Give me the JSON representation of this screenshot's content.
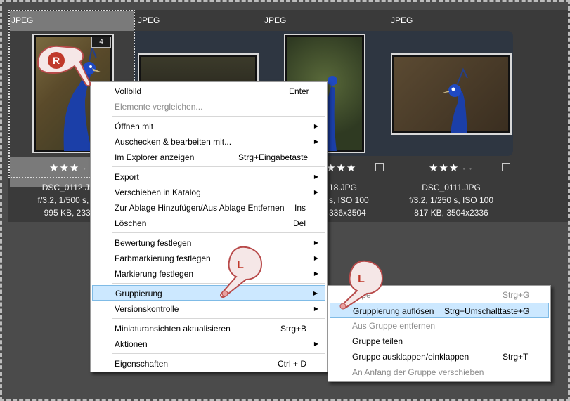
{
  "thumbnails": [
    {
      "format": "JPEG",
      "badge": "4",
      "stars": "★★★",
      "filename": "DSC_0112.JPG",
      "exposure": "f/3.2, 1/500 s, ISO",
      "size": "995 KB, 2336x"
    },
    {
      "format": "JPEG"
    },
    {
      "format": "JPEG",
      "stars": "★★★",
      "filename": "18.JPG",
      "exposure": "s, ISO 100",
      "size": "336x3504"
    },
    {
      "format": "JPEG",
      "stars": "★★★",
      "filename": "DSC_0111.JPG",
      "exposure": "f/3.2, 1/250 s, ISO 100",
      "size": "817 KB, 3504x2336"
    }
  ],
  "context_menu": {
    "items": [
      {
        "label": "Vollbild",
        "shortcut": "Enter"
      },
      {
        "label": "Elemente vergleichen...",
        "disabled": true
      },
      {
        "label": "Öffnen mit",
        "arrow": true
      },
      {
        "label": "Auschecken & bearbeiten mit...",
        "arrow": true
      },
      {
        "label": "Im Explorer anzeigen",
        "shortcut": "Strg+Eingabetaste"
      },
      {
        "label": "Export",
        "arrow": true
      },
      {
        "label": "Verschieben in Katalog",
        "arrow": true
      },
      {
        "label": "Zur Ablage Hinzufügen/Aus Ablage Entfernen",
        "shortcut": "Ins"
      },
      {
        "label": "Löschen",
        "shortcut": "Del"
      },
      {
        "label": "Bewertung festlegen",
        "arrow": true
      },
      {
        "label": "Farbmarkierung festlegen",
        "arrow": true
      },
      {
        "label": "Markierung festlegen",
        "arrow": true
      },
      {
        "label": "Gruppierung",
        "arrow": true,
        "highlighted": true
      },
      {
        "label": "Versionskontrolle",
        "arrow": true
      },
      {
        "label": "Miniaturansichten aktualisieren",
        "shortcut": "Strg+B"
      },
      {
        "label": "Aktionen",
        "arrow": true
      },
      {
        "label": "Eigenschaften",
        "shortcut": "Ctrl + D"
      }
    ]
  },
  "submenu": {
    "items": [
      {
        "label": "uppe",
        "shortcut": "Strg+G",
        "disabled": true
      },
      {
        "label": "Gruppierung auflösen",
        "shortcut": "Strg+Umschalttaste+G",
        "highlighted": true
      },
      {
        "label": "Aus Gruppe entfernen",
        "disabled": true
      },
      {
        "label": "Gruppe teilen"
      },
      {
        "label": "Gruppe ausklappen/einklappen",
        "shortcut": "Strg+T"
      },
      {
        "label": "An Anfang der Gruppe verschieben",
        "disabled": true
      }
    ]
  },
  "hands": {
    "right_click": "R",
    "left_click_1": "L",
    "left_click_2": "L"
  },
  "icons": {
    "submenu_arrow": "▶",
    "rating_dot": "◦"
  },
  "colors": {
    "highlight": "#cce8ff",
    "group_bg": "#2e3641"
  }
}
